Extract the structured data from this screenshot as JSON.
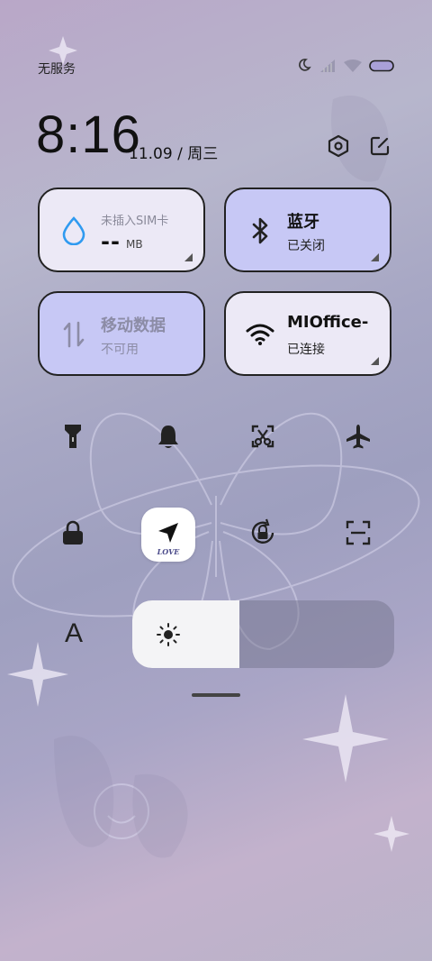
{
  "status_bar": {
    "carrier": "无服务",
    "icons": [
      "moon-icon",
      "signal-icon",
      "wifi-icon",
      "battery-icon"
    ],
    "battery_color": "#a9a0d8"
  },
  "header": {
    "time": "8:16",
    "date": "11.09 / 周三",
    "settings_icon": "settings-hexagon-icon",
    "edit_icon": "edit-icon"
  },
  "tiles": {
    "data_usage": {
      "label": "未插入SIM卡",
      "value": "--",
      "unit": "MB",
      "icon": "water-drop-icon",
      "icon_color": "#2f9af0"
    },
    "bluetooth": {
      "title": "蓝牙",
      "status": "已关闭",
      "icon": "bluetooth-icon"
    },
    "mobile_data": {
      "title": "移动数据",
      "status": "不可用",
      "icon": "updown-arrows-icon"
    },
    "wifi": {
      "title": "MIOffice-",
      "status": "已连接",
      "icon": "wifi-icon"
    }
  },
  "toggles_row1": [
    "flashlight-icon",
    "bell-icon",
    "screenshot-scissor-icon",
    "airplane-icon"
  ],
  "toggles_row2": [
    "lock-icon",
    "location-icon",
    "rotation-lock-icon",
    "scan-icon"
  ],
  "location_badge": "LOVE",
  "brightness": {
    "font_label": "A",
    "level": 0.41
  },
  "colors": {
    "tile_light": "#ece9f6",
    "tile_blue": "#c7c8f5"
  }
}
